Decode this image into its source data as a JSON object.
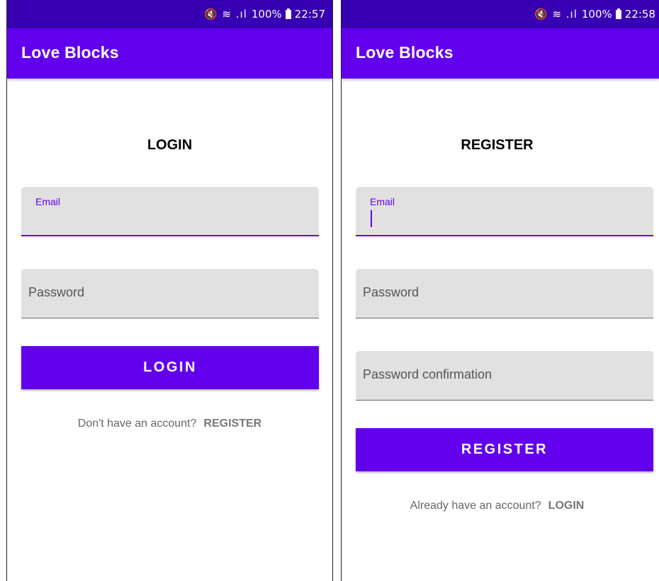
{
  "login_screen": {
    "status": {
      "icons": "🔇 ≋ .ıl",
      "battery": "100%",
      "time": "22:57"
    },
    "app_title": "Love Blocks",
    "heading": "LOGIN",
    "email_label": "Email",
    "password_placeholder": "Password",
    "submit_label": "LOGIN",
    "switch_prompt": "Don't have an account?",
    "switch_link": "REGISTER"
  },
  "register_screen": {
    "status": {
      "icons": "🔇 ≋ .ıl",
      "battery": "100%",
      "time": "22:58"
    },
    "app_title": "Love Blocks",
    "heading": "REGISTER",
    "email_label": "Email",
    "password_placeholder": "Password",
    "password_confirmation_placeholder": "Password confirmation",
    "submit_label": "REGISTER",
    "switch_prompt": "Already have an account?",
    "switch_link": "LOGIN"
  },
  "colors": {
    "status_bar": "#3700b3",
    "app_bar": "#6200ee",
    "field_background": "#e1e1e1",
    "link_text": "#777777"
  }
}
